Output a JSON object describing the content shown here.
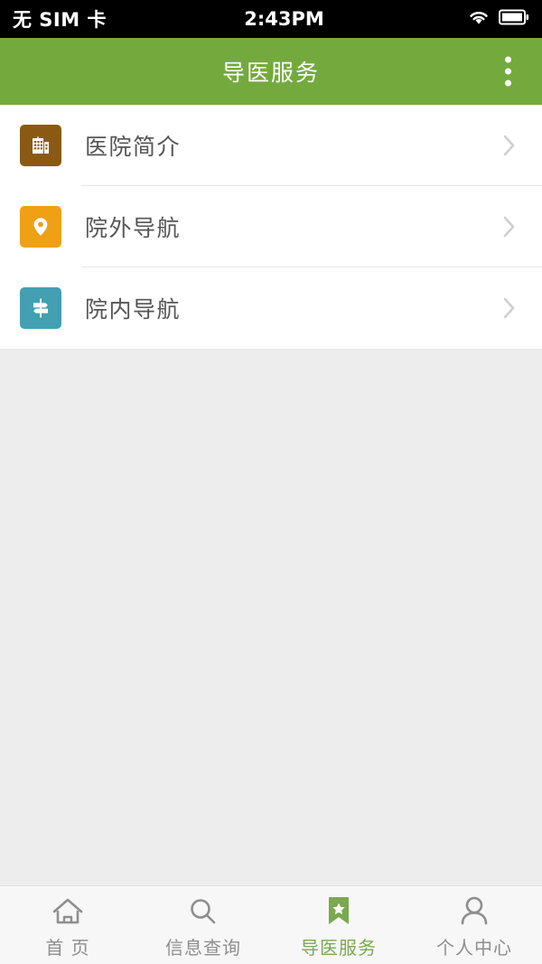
{
  "status_bar": {
    "carrier": "无 SIM 卡",
    "time": "2:43PM",
    "wifi_icon": "wifi-icon",
    "battery_icon": "battery-icon"
  },
  "header": {
    "title": "导医服务",
    "menu_icon": "overflow-menu-icon",
    "background_color": "#74aa3d",
    "title_color": "#ffffff"
  },
  "list": {
    "items": [
      {
        "label": "医院简介",
        "icon": "hospital-building-icon",
        "icon_color": "#8a5a15",
        "chevron": "chevron-right-icon"
      },
      {
        "label": "院外导航",
        "icon": "map-pin-icon",
        "icon_color": "#efa014",
        "chevron": "chevron-right-icon"
      },
      {
        "label": "院内导航",
        "icon": "signpost-icon",
        "icon_color": "#42a0b2",
        "chevron": "chevron-right-icon"
      }
    ]
  },
  "tabbar": {
    "active_color": "#7aa94e",
    "inactive_color": "#8e8e8e",
    "tabs": [
      {
        "label": "首 页",
        "icon": "home-icon",
        "active": false
      },
      {
        "label": "信息查询",
        "icon": "search-icon",
        "active": false
      },
      {
        "label": "导医服务",
        "icon": "bookmark-star-icon",
        "active": true
      },
      {
        "label": "个人中心",
        "icon": "person-icon",
        "active": false
      }
    ]
  }
}
